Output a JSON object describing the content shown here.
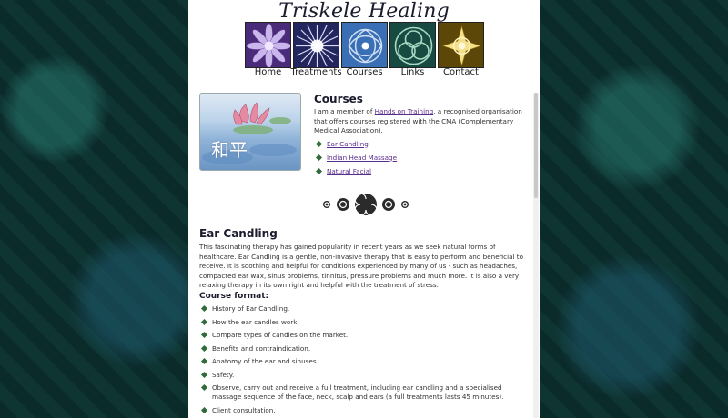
{
  "site": {
    "title": "Triskele Healing"
  },
  "nav": {
    "items": [
      {
        "label": "Home",
        "colors": [
          "#6b3fa0",
          "#c9b6ea"
        ]
      },
      {
        "label": "Treatments",
        "colors": [
          "#3b3f9c",
          "#d9dcf3"
        ]
      },
      {
        "label": "Courses",
        "colors": [
          "#2e5fa8",
          "#cfe0f5"
        ]
      },
      {
        "label": "Links",
        "colors": [
          "#1f6b5a",
          "#a8d9c4"
        ]
      },
      {
        "label": "Contact",
        "colors": [
          "#9a7a10",
          "#f4e08a"
        ]
      }
    ]
  },
  "courses_intro": {
    "heading": "Courses",
    "text_before_link": "I am a member of ",
    "link_text": "Hands on Training",
    "text_after_link": ", a recognised organisation that offers courses registered with the CMA (Complementary Medical Association).",
    "courses": [
      "Ear Candling",
      "Indian Head Massage",
      "Natural Facial"
    ],
    "hero_kanji": "和平"
  },
  "ear_candling": {
    "heading": "Ear Candling",
    "description": "This fascinating therapy has gained popularity in recent years as we seek natural forms of healthcare. Ear Candling is a gentle, non-invasive therapy that is easy to perform and beneficial to receive. It is soothing and helpful for conditions experienced by many of us - such as headaches, compacted ear wax, sinus problems, tinnitus, pressure problems and much more. It is also a very relaxing therapy in its own right and helpful with the treatment of stress.",
    "format_heading": "Course format:",
    "format_items": [
      "History of Ear Candling.",
      "How the ear candles work.",
      "Compare types of candles on the market.",
      "Benefits and contraindication.",
      "Anatomy of the ear and sinuses.",
      "Safety.",
      "Observe, carry out and receive a full treatment, including ear candling and a specialised massage sequence of the face, neck, scalp and ears (a full treatments lasts 45 minutes).",
      "Client consultation."
    ]
  },
  "colors": {
    "accent_link": "#5a2d8c",
    "bullet": "#2f6b3b"
  }
}
